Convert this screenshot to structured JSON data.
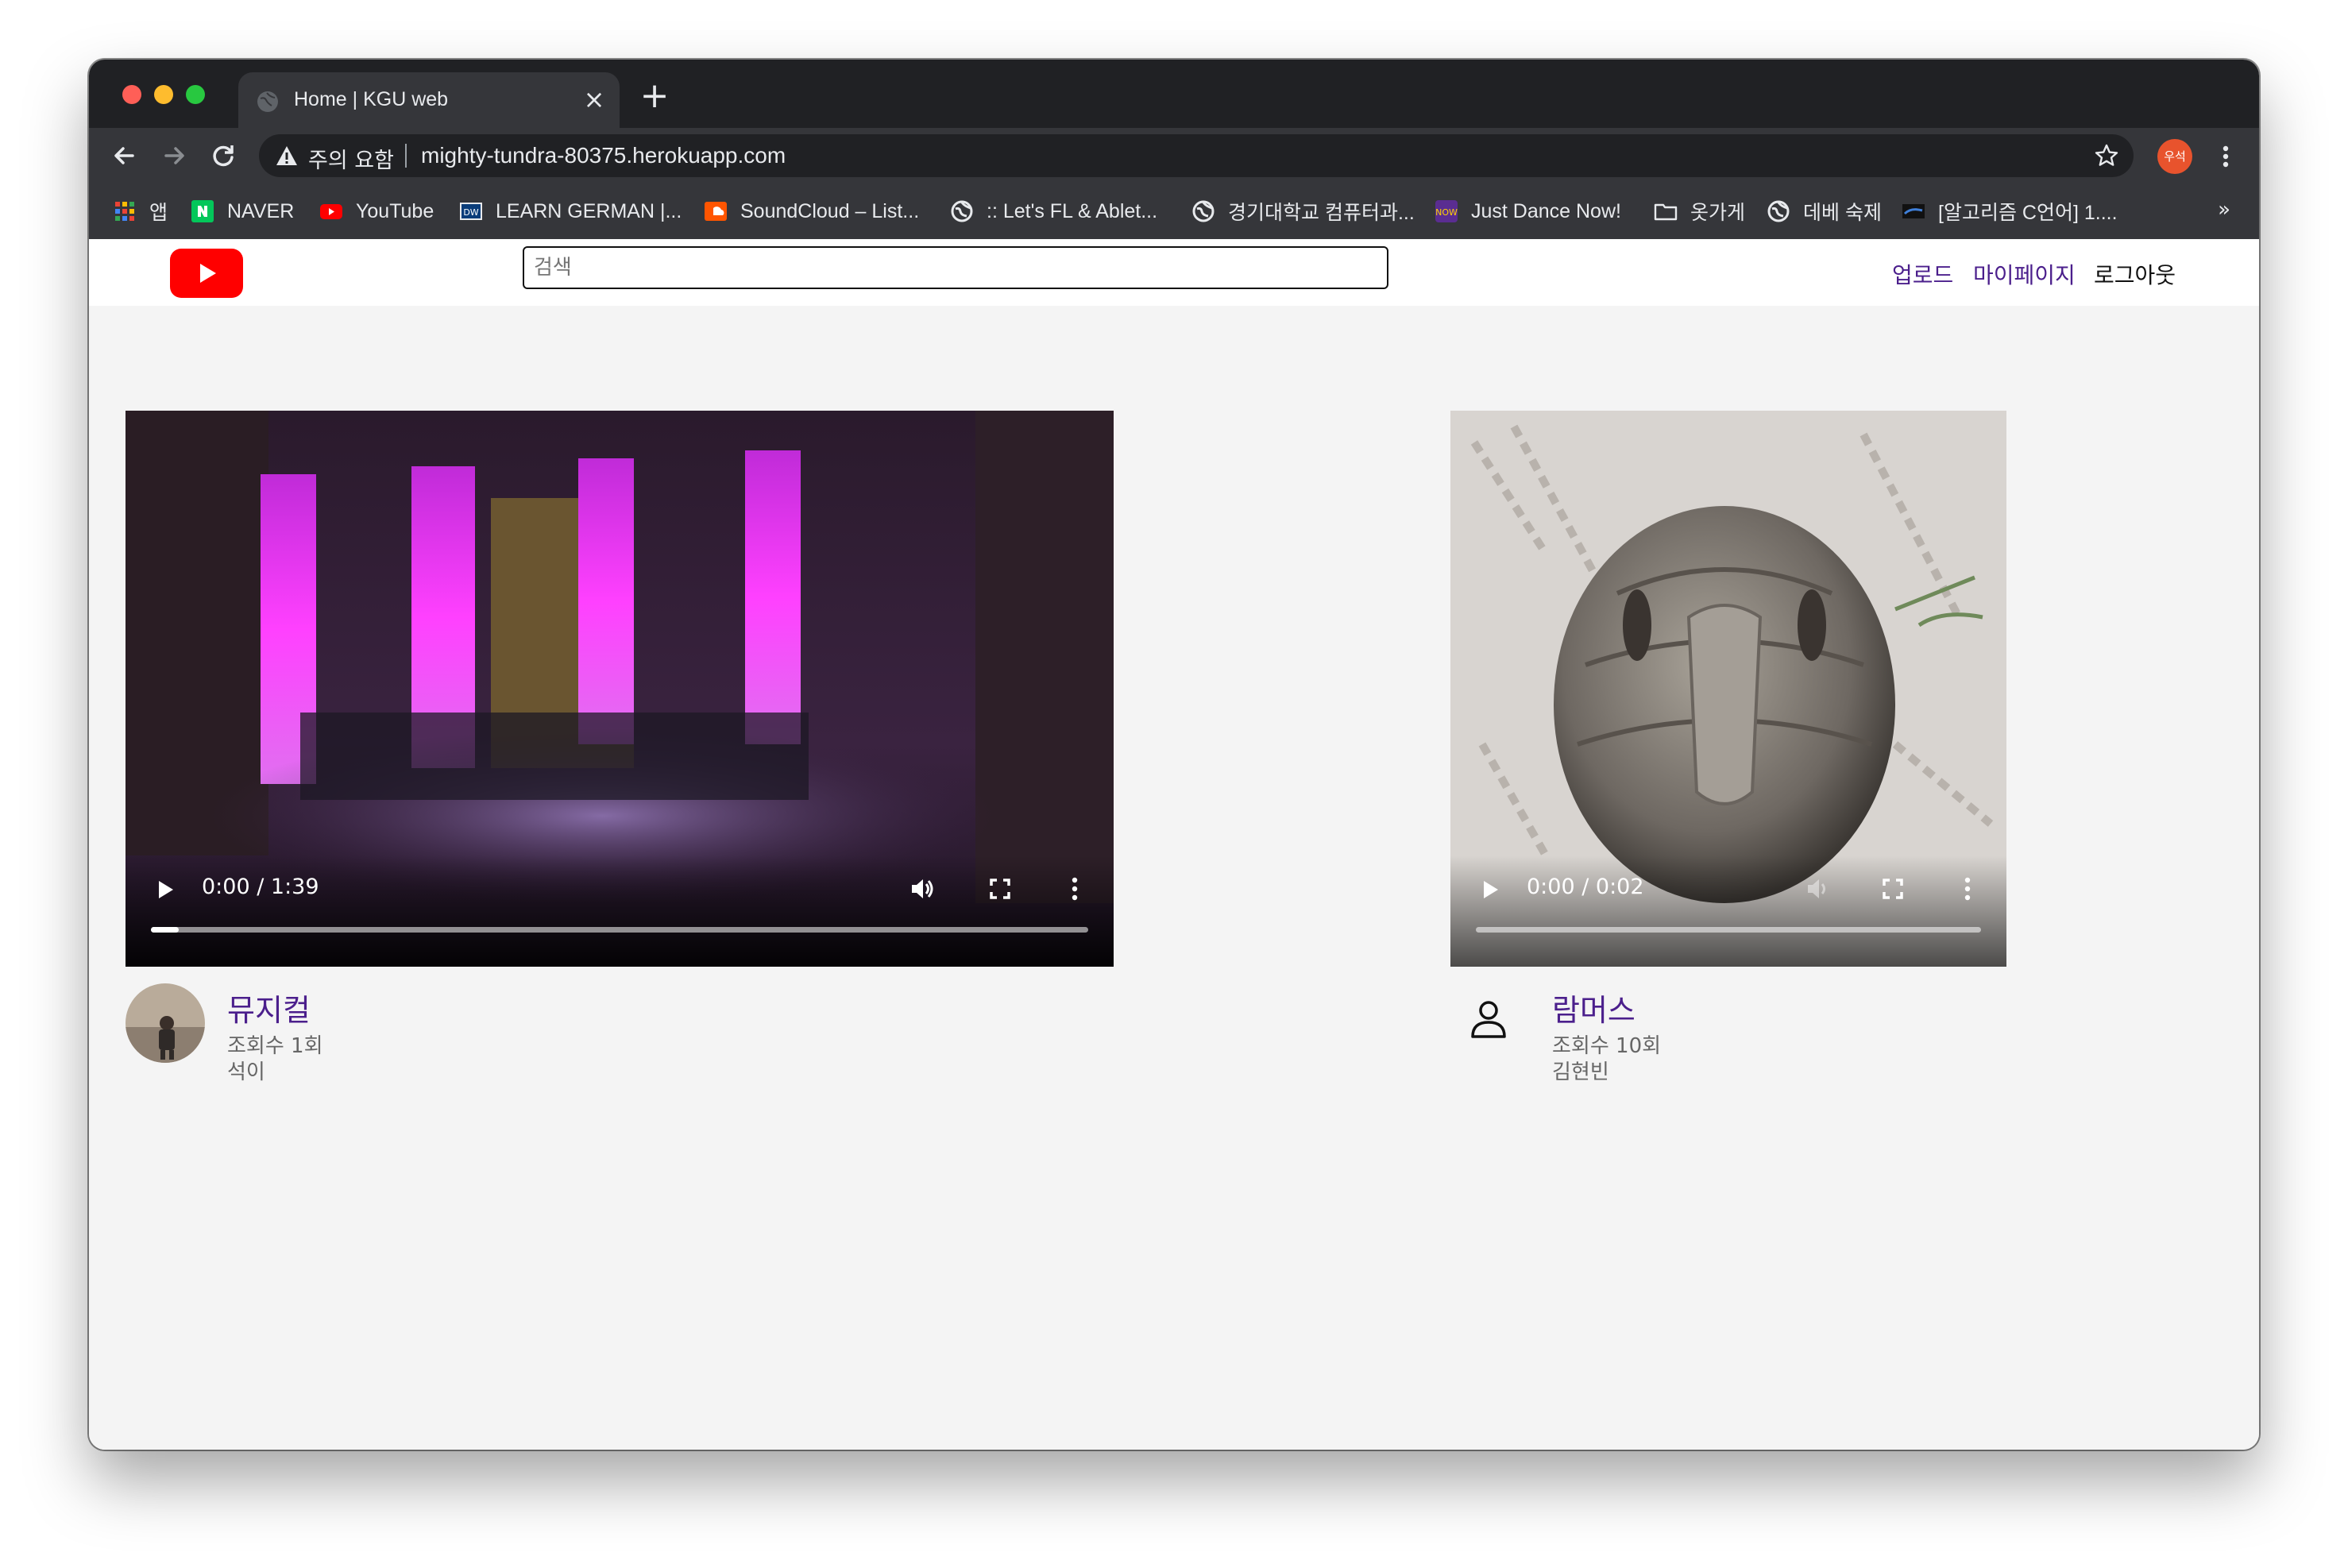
{
  "browser": {
    "tab_title": "Home | KGU web",
    "new_tab_symbol": "+",
    "close_symbol": "×",
    "security_label": "주의 요함",
    "url": "mighty-tundra-80375.herokuapp.com",
    "profile_initials": "우석",
    "more_bookmarks": "»"
  },
  "bookmarks": [
    {
      "label": "앱",
      "icon": "apps-grid-icon"
    },
    {
      "label": "NAVER",
      "icon": "naver-icon"
    },
    {
      "label": "YouTube",
      "icon": "youtube-icon"
    },
    {
      "label": "LEARN GERMAN |...",
      "icon": "dw-icon"
    },
    {
      "label": "SoundCloud – List...",
      "icon": "soundcloud-icon"
    },
    {
      "label": ":: Let's FL & Ablet...",
      "icon": "globe-icon"
    },
    {
      "label": "경기대학교 컴퓨터과...",
      "icon": "globe-icon"
    },
    {
      "label": "Just Dance Now!",
      "icon": "justdance-icon"
    },
    {
      "label": "옷가게",
      "icon": "folder-icon"
    },
    {
      "label": "데베 숙제",
      "icon": "globe-icon"
    },
    {
      "label": "[알고리즘 C언어] 1....",
      "icon": "site-icon"
    }
  ],
  "site": {
    "search_placeholder": "검색",
    "nav": {
      "upload": "업로드",
      "mypage": "마이페이지",
      "logout": "로그아웃"
    }
  },
  "videos": [
    {
      "title": "뮤지컬",
      "views": "조회수 1회",
      "author": "석이",
      "time": "0:00 / 1:39",
      "progress": 0.03,
      "muted": false
    },
    {
      "title": "람머스",
      "views": "조회수 10회",
      "author": "김현빈",
      "time": "0:00 / 0:02",
      "progress": 0.0,
      "muted": true
    }
  ],
  "colors": {
    "link": "#4b1f8c",
    "logo": "#ff0000",
    "profile": "#e8532d"
  }
}
